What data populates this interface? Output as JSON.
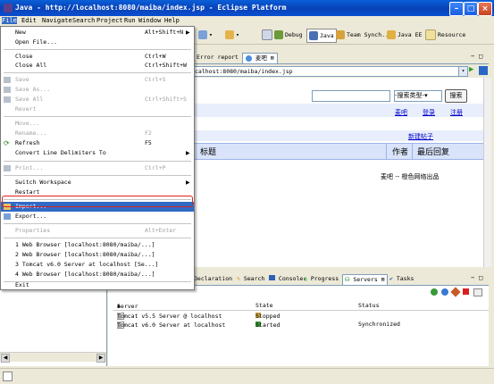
{
  "window": {
    "title": "Java - http://localhost:8080/maiba/index.jsp - Eclipse Platform"
  },
  "menubar": {
    "items": [
      "File",
      "Edit",
      "Navigate",
      "Search",
      "Project",
      "Run",
      "Window",
      "Help"
    ]
  },
  "toolbar": {
    "debug": "Debug",
    "java": "Java",
    "team_synch": "Team Synch...",
    "java_ee": "Java EE",
    "resource": "Resource"
  },
  "editor": {
    "tabs": [
      "Error report",
      "麦吧"
    ],
    "url": "calhost:8080/maiba/index.jsp",
    "page": {
      "search_select": "-搜索类型-",
      "search_button": "搜索",
      "links": [
        "麦吧",
        "登录",
        "注册"
      ],
      "new_post": "新建帖子",
      "columns": [
        "标题",
        "作者",
        "最后回复"
      ],
      "footer": "麦吧 -- 橙色网络出品"
    }
  },
  "bottom": {
    "tabs": [
      "Declaration",
      "Search",
      "Console",
      "Progress",
      "Servers",
      "Tasks"
    ],
    "servers": {
      "headers": [
        "Server",
        "State",
        "Status"
      ],
      "rows": [
        {
          "server": "Tomcat v5.5 Server @ localhost",
          "state": "Stopped",
          "status": ""
        },
        {
          "server": "Tomcat v6.0 Server at localhost",
          "state": "Started",
          "status": "Synchronized"
        }
      ]
    }
  },
  "file_menu": {
    "items": [
      {
        "label": "New",
        "accel": "Alt+Shift+N",
        "submenu": true,
        "disabled": false
      },
      {
        "label": "Open File...",
        "accel": "",
        "disabled": false
      },
      {
        "label": "Close",
        "accel": "Ctrl+W",
        "disabled": false
      },
      {
        "label": "Close All",
        "accel": "Ctrl+Shift+W",
        "disabled": false
      },
      {
        "label": "Save",
        "accel": "Ctrl+S",
        "disabled": true
      },
      {
        "label": "Save As...",
        "accel": "",
        "disabled": true
      },
      {
        "label": "Save All",
        "accel": "Ctrl+Shift+S",
        "disabled": true
      },
      {
        "label": "Revert",
        "accel": "",
        "disabled": true
      },
      {
        "label": "Move...",
        "accel": "",
        "disabled": true
      },
      {
        "label": "Rename...",
        "accel": "F2",
        "disabled": true
      },
      {
        "label": "Refresh",
        "accel": "F5",
        "disabled": false
      },
      {
        "label": "Convert Line Delimiters To",
        "accel": "",
        "submenu": true,
        "disabled": false
      },
      {
        "label": "Print...",
        "accel": "Ctrl+P",
        "disabled": true
      },
      {
        "label": "Switch Workspace",
        "accel": "",
        "submenu": true,
        "disabled": false
      },
      {
        "label": "Restart",
        "accel": "",
        "disabled": false
      },
      {
        "label": "Import...",
        "accel": "",
        "disabled": false,
        "highlighted": true
      },
      {
        "label": "Export...",
        "accel": "",
        "disabled": false
      },
      {
        "label": "Properties",
        "accel": "Alt+Enter",
        "disabled": true
      },
      {
        "label": "1 Web Browser  [localhost:8080/maiba/...]",
        "accel": "",
        "disabled": false
      },
      {
        "label": "2 Web Browser  [localhost:8080/maiba/...]",
        "accel": "",
        "disabled": false
      },
      {
        "label": "3 Tomcat v6.0 Server at localhost  [Se...]",
        "accel": "",
        "disabled": false
      },
      {
        "label": "4 Web Browser  [localhost:8080/maiba/...]",
        "accel": "",
        "disabled": false
      },
      {
        "label": "Exit",
        "accel": "",
        "disabled": false
      }
    ]
  },
  "colors": {
    "highlight": "#316ac5",
    "titlebar": "#0842b8",
    "annotation": "#e02020"
  }
}
